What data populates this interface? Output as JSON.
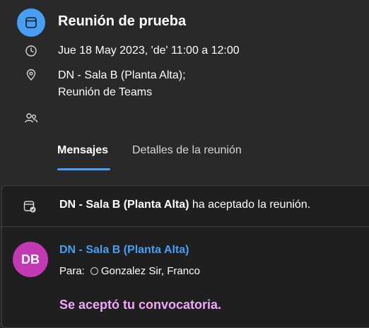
{
  "meeting": {
    "title": "Reunión de prueba",
    "datetime": "Jue 18 May 2023, 'de' 11:00 a 12:00",
    "location_line1": "DN - Sala B (Planta Alta);",
    "location_line2": "Reunión de Teams"
  },
  "tabs": [
    {
      "label": "Mensajes",
      "active": true
    },
    {
      "label": "Detalles de la reunión",
      "active": false
    }
  ],
  "notification": {
    "actor": "DN - Sala B (Planta Alta)",
    "text": "ha aceptado la reunión."
  },
  "message": {
    "avatar_initials": "DB",
    "avatar_color": "#c239b3",
    "sender": "DN - Sala B (Planta Alta)",
    "to_label": "Para:",
    "recipient": "Gonzalez Sir, Franco",
    "body_heading": "Se aceptó tu convocatoria."
  },
  "icons": {
    "header": "calendar-icon",
    "time": "clock-icon",
    "location": "location-pin-icon",
    "attendees": "people-icon",
    "notice": "calendar-check-icon",
    "presence": "presence-status-icon"
  },
  "colors": {
    "background": "#292929",
    "panel": "#1f1f1f",
    "accent": "#479ef5",
    "avatar": "#c239b3",
    "accepted_text": "#f0a8f8"
  }
}
